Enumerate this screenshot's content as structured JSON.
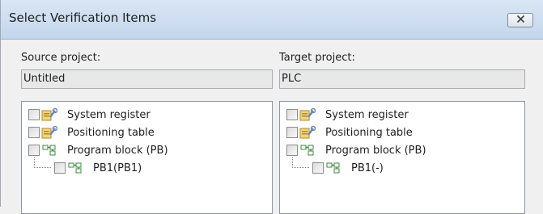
{
  "window": {
    "title": "Select Verification Items"
  },
  "source": {
    "label": "Source project:",
    "value": "Untitled",
    "tree": [
      "System register",
      "Positioning table",
      "Program block (PB)",
      "PB1(PB1)"
    ]
  },
  "target": {
    "label": "Target project:",
    "value": "PLC",
    "tree": [
      "System register",
      "Positioning table",
      "Program block (PB)",
      "PB1(-)"
    ]
  },
  "icons": {
    "system_register": "register-tools-icon",
    "positioning_table": "table-tools-icon",
    "program_block": "program-block-icon",
    "pb_child": "program-block-icon",
    "close": "close-icon"
  }
}
